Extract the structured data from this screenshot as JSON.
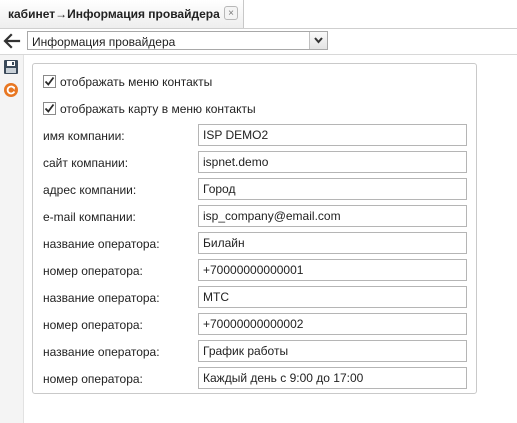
{
  "tab": {
    "title": "кабинет→Информация провайдера",
    "close": "×"
  },
  "toolbar": {
    "back_icon": "arrow-left-icon",
    "select_value": "Информация провайдера"
  },
  "side_icons": [
    "save-icon",
    "refresh-icon"
  ],
  "form": {
    "checkboxes": [
      {
        "label": "отображать меню контакты",
        "checked": true
      },
      {
        "label": "отображать карту в меню контакты",
        "checked": true
      }
    ],
    "fields": [
      {
        "label": "имя компании:",
        "value": "ISP DEMO2"
      },
      {
        "label": "сайт компании:",
        "value": "ispnet.demo"
      },
      {
        "label": "адрес компании:",
        "value": "Город"
      },
      {
        "label": "e-mail компании:",
        "value": "isp_company@email.com"
      },
      {
        "label": "название оператора:",
        "value": "Билайн"
      },
      {
        "label": "номер оператора:",
        "value": "+70000000000001"
      },
      {
        "label": "название оператора:",
        "value": "МТС"
      },
      {
        "label": "номер оператора:",
        "value": "+70000000000002"
      },
      {
        "label": "название оператора:",
        "value": "График работы"
      },
      {
        "label": "номер оператора:",
        "value": "Каждый день с 9:00 до 17:00"
      }
    ]
  },
  "colors": {
    "checkmark": "#2a2a2a",
    "save_icon": "#3b4a5a",
    "refresh_icon": "#e87722"
  }
}
